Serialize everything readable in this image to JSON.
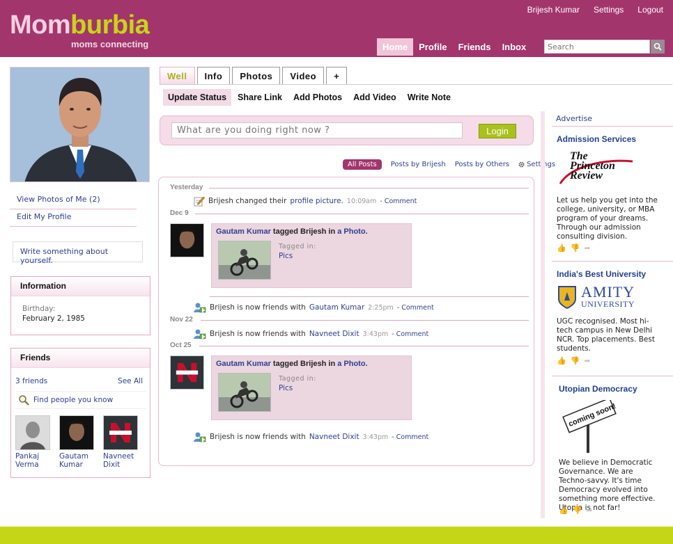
{
  "brand": {
    "name_part1": "Mom",
    "name_part2": "burbia",
    "tagline": "moms connecting"
  },
  "top_links": {
    "user": "Brijesh Kumar",
    "settings": "Settings",
    "logout": "Logout"
  },
  "main_nav": {
    "home": "Home",
    "profile": "Profile",
    "friends": "Friends",
    "inbox": "Inbox"
  },
  "search": {
    "placeholder": "Search"
  },
  "left": {
    "view_photos": "View Photos of Me (2)",
    "edit_profile": "Edit My Profile",
    "about_prompt": "Write something about yourself.",
    "info": {
      "title": "Information",
      "birthday_label": "Birthday:",
      "birthday_value": "February 2, 1985"
    },
    "friends": {
      "title": "Friends",
      "count": "3 friends",
      "see_all": "See All",
      "find": "Find people you know",
      "list": [
        {
          "line1": "Pankaj",
          "line2": "Verma"
        },
        {
          "line1": "Gautam",
          "line2": "Kumar"
        },
        {
          "line1": "Navneet",
          "line2": "Dixit"
        }
      ]
    }
  },
  "tabs": {
    "wall": "Well",
    "info": "Info",
    "photos": "Photos",
    "video": "Video",
    "add": "+"
  },
  "actions": {
    "update_status": "Update Status",
    "share_link": "Share Link",
    "add_photos": "Add Photos",
    "add_video": "Add Video",
    "write_note": "Write Note"
  },
  "status": {
    "placeholder": "What are you doing right now ?",
    "button": "Login"
  },
  "feed_filters": {
    "all": "All Posts",
    "by_me": "Posts by Brijesh",
    "by_others": "Posts by Others",
    "settings": "Settings"
  },
  "feed": {
    "dates": {
      "d1": "Yesterday",
      "d2": "Dec 9",
      "d3": "Nov 22",
      "d4": "Oct 25"
    },
    "s1": {
      "pre": "Brijesh changed their",
      "link": "profile picture.",
      "time": "10:09am",
      "comment": "- Comment"
    },
    "tag1": {
      "name": "Gautam Kumar",
      "mid": "tagged Brijesh in",
      "link": "a Photo",
      "dot": ".",
      "tagged_label": "Tagged in:",
      "tagged_value": "Pics"
    },
    "s2": {
      "pre": "Brijesh is now friends with",
      "link": "Gautam Kumar",
      "time": "2:25pm",
      "comment": "- Comment"
    },
    "s3": {
      "pre": "Brijesh is now friends with",
      "link": "Navneet Dixit",
      "time": "3:43pm",
      "comment": "- Comment"
    },
    "tag2": {
      "name": "Gautam Kumar",
      "mid": "tagged Brijesh in",
      "link": "a Photo",
      "dot": ".",
      "tagged_label": "Tagged in:",
      "tagged_value": "Pics"
    },
    "s4": {
      "pre": "Brijesh is now friends with",
      "link": "Navneet Dixit",
      "time": "3:43pm",
      "comment": "- Comment"
    }
  },
  "right": {
    "advertise": "Advertise",
    "ads": [
      {
        "title": "Admission Services",
        "logo_l1": "The",
        "logo_l2": "Princeton",
        "logo_l3": "Review",
        "body": "Let us help you get into the college, university, or MBA program of your dreams. Through our admission consulting division."
      },
      {
        "title": "India's Best University",
        "logo_l1": "AMITY",
        "logo_l2": "UNIVERSITY",
        "body": "UGC recognised. Most hi-tech campus in New Delhi NCR. Top placements. Best students."
      },
      {
        "title": "Utopian Democracy",
        "logo_l1": "coming soon!",
        "body": "We believe in Democratic Governance. We are Techno-savvy. It's time Democracy evolved into something more effective. Utopia is not far!"
      }
    ]
  },
  "colors": {
    "header": "#a3356d",
    "accent_green": "#c5d616",
    "pink_light": "#f5dce8",
    "link": "#2d3f8e"
  }
}
